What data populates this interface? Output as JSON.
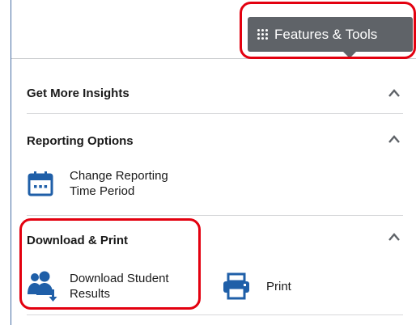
{
  "header": {
    "features_tools_label": "Features & Tools"
  },
  "sections": {
    "insights": {
      "title": "Get More Insights"
    },
    "reporting": {
      "title": "Reporting Options",
      "change_period_label": "Change Reporting\nTime Period"
    },
    "download_print": {
      "title": "Download & Print",
      "download_label": "Download Student\nResults",
      "print_label": "Print"
    }
  },
  "colors": {
    "button_bg": "#5f6368",
    "highlight": "#e3000f",
    "icon_blue": "#1f5fa8"
  },
  "icons": [
    "grid-dots-icon",
    "chevron-up-icon",
    "calendar-icon",
    "download-users-icon",
    "printer-icon"
  ]
}
